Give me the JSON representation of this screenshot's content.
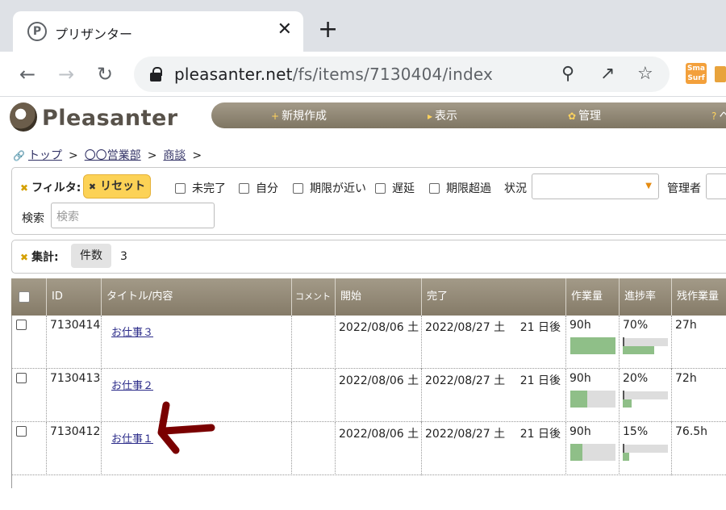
{
  "browser": {
    "tab_icon": "P",
    "tab_title": "プリザンター",
    "tab_close": "✕",
    "new_tab": "+",
    "url_host": "pleasanter.net",
    "url_path": "/fs/items/7130404/index",
    "extension_label": "Sma Surf"
  },
  "app": {
    "logo_text": "Pleasanter",
    "menu": [
      {
        "icon": "+",
        "label": "新規作成"
      },
      {
        "icon": "▸",
        "label": "表示"
      },
      {
        "icon": "✿",
        "label": "管理"
      },
      {
        "icon": "?",
        "label": "ヘ"
      }
    ]
  },
  "breadcrumb": {
    "items": [
      "トップ",
      "〇〇営業部",
      "商談"
    ],
    "separator": ">"
  },
  "filter": {
    "label": "フィルタ:",
    "reset_label": "リセット",
    "checkboxes": [
      "未完了",
      "自分",
      "期限が近い",
      "遅延",
      "期限超過"
    ],
    "status_label": "状況",
    "manager_label": "管理者",
    "search_label": "検索",
    "search_placeholder": "検索"
  },
  "aggregate": {
    "label": "集計:",
    "chip": "件数",
    "value": "3"
  },
  "grid": {
    "columns": [
      "ID",
      "タイトル/内容",
      "コメント",
      "開始",
      "完了",
      "作業量",
      "進捗率",
      "残作業量"
    ],
    "rows": [
      {
        "id": "7130414",
        "title": "お仕事３",
        "comment": "",
        "start": "2022/08/06 土",
        "end": "2022/08/27 土",
        "remaining_days": "21 日後",
        "workload": "90h",
        "workload_fill": 1.0,
        "progress": "70%",
        "progress_value": 0.7,
        "remaining": "27h"
      },
      {
        "id": "7130413",
        "title": "お仕事２",
        "comment": "",
        "start": "2022/08/06 土",
        "end": "2022/08/27 土",
        "remaining_days": "21 日後",
        "workload": "90h",
        "workload_fill": 0.38,
        "progress": "20%",
        "progress_value": 0.2,
        "remaining": "72h"
      },
      {
        "id": "7130412",
        "title": "お仕事１",
        "comment": "",
        "start": "2022/08/06 土",
        "end": "2022/08/27 土",
        "remaining_days": "21 日後",
        "workload": "90h",
        "workload_fill": 0.27,
        "progress": "15%",
        "progress_value": 0.15,
        "remaining": "76.5h"
      }
    ]
  },
  "colors": {
    "menubar": "#8f8674",
    "accent_yellow": "#fcd256",
    "bar_fill": "#8fbf88",
    "annotation_arrow": "#7a0000"
  }
}
